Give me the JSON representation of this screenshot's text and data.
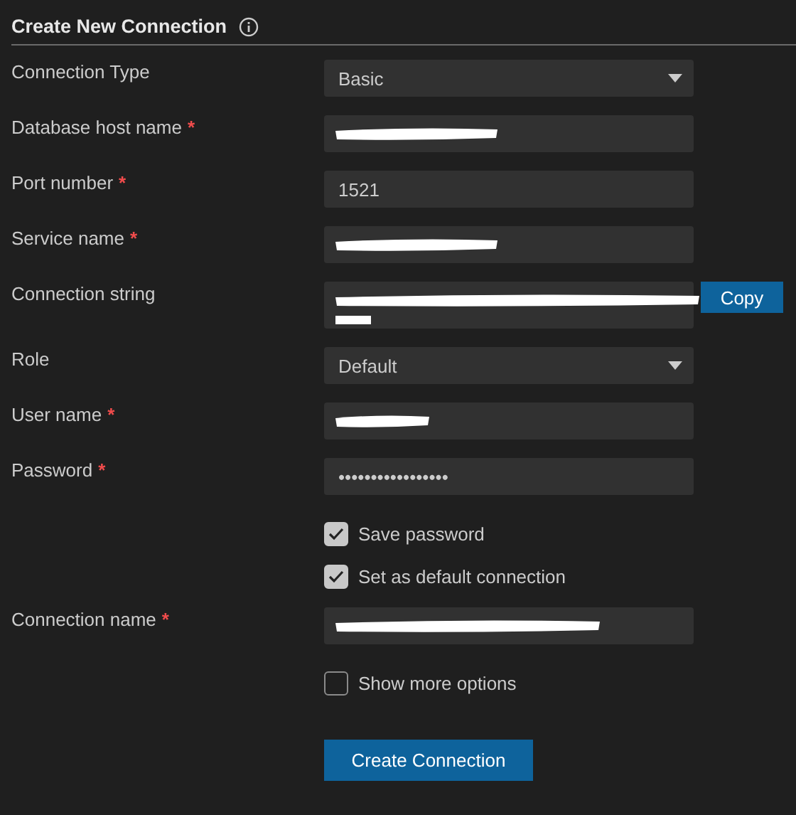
{
  "header": {
    "title": "Create New Connection"
  },
  "fields": [
    {
      "kind": "select",
      "label": "Connection Type",
      "value": "Basic"
    },
    {
      "kind": "text",
      "label": "Database host name",
      "required_mark": "*",
      "redacted": true
    },
    {
      "kind": "text",
      "label": "Port number",
      "required_mark": "*",
      "value": "1521"
    },
    {
      "kind": "text",
      "label": "Service name",
      "required_mark": "*",
      "redacted": true
    },
    {
      "kind": "copy",
      "label": "Connection string",
      "redacted": true,
      "button": "Copy"
    },
    {
      "kind": "select",
      "label": "Role",
      "value": "Default"
    },
    {
      "kind": "text",
      "label": "User name",
      "required_mark": "*",
      "redacted": true
    },
    {
      "kind": "text",
      "label": "Password",
      "required_mark": "*",
      "value": "•••••••••••••••••"
    },
    {
      "kind": "checkbox",
      "label": "Save password",
      "checked": true
    },
    {
      "kind": "checkbox",
      "label": "Set as default connection",
      "checked": true
    },
    {
      "kind": "text",
      "label": "Connection name",
      "required_mark": "*",
      "redacted": true
    },
    {
      "kind": "checkbox",
      "label": "Show more options",
      "checked": false
    }
  ],
  "submit": {
    "label": "Create Connection"
  }
}
